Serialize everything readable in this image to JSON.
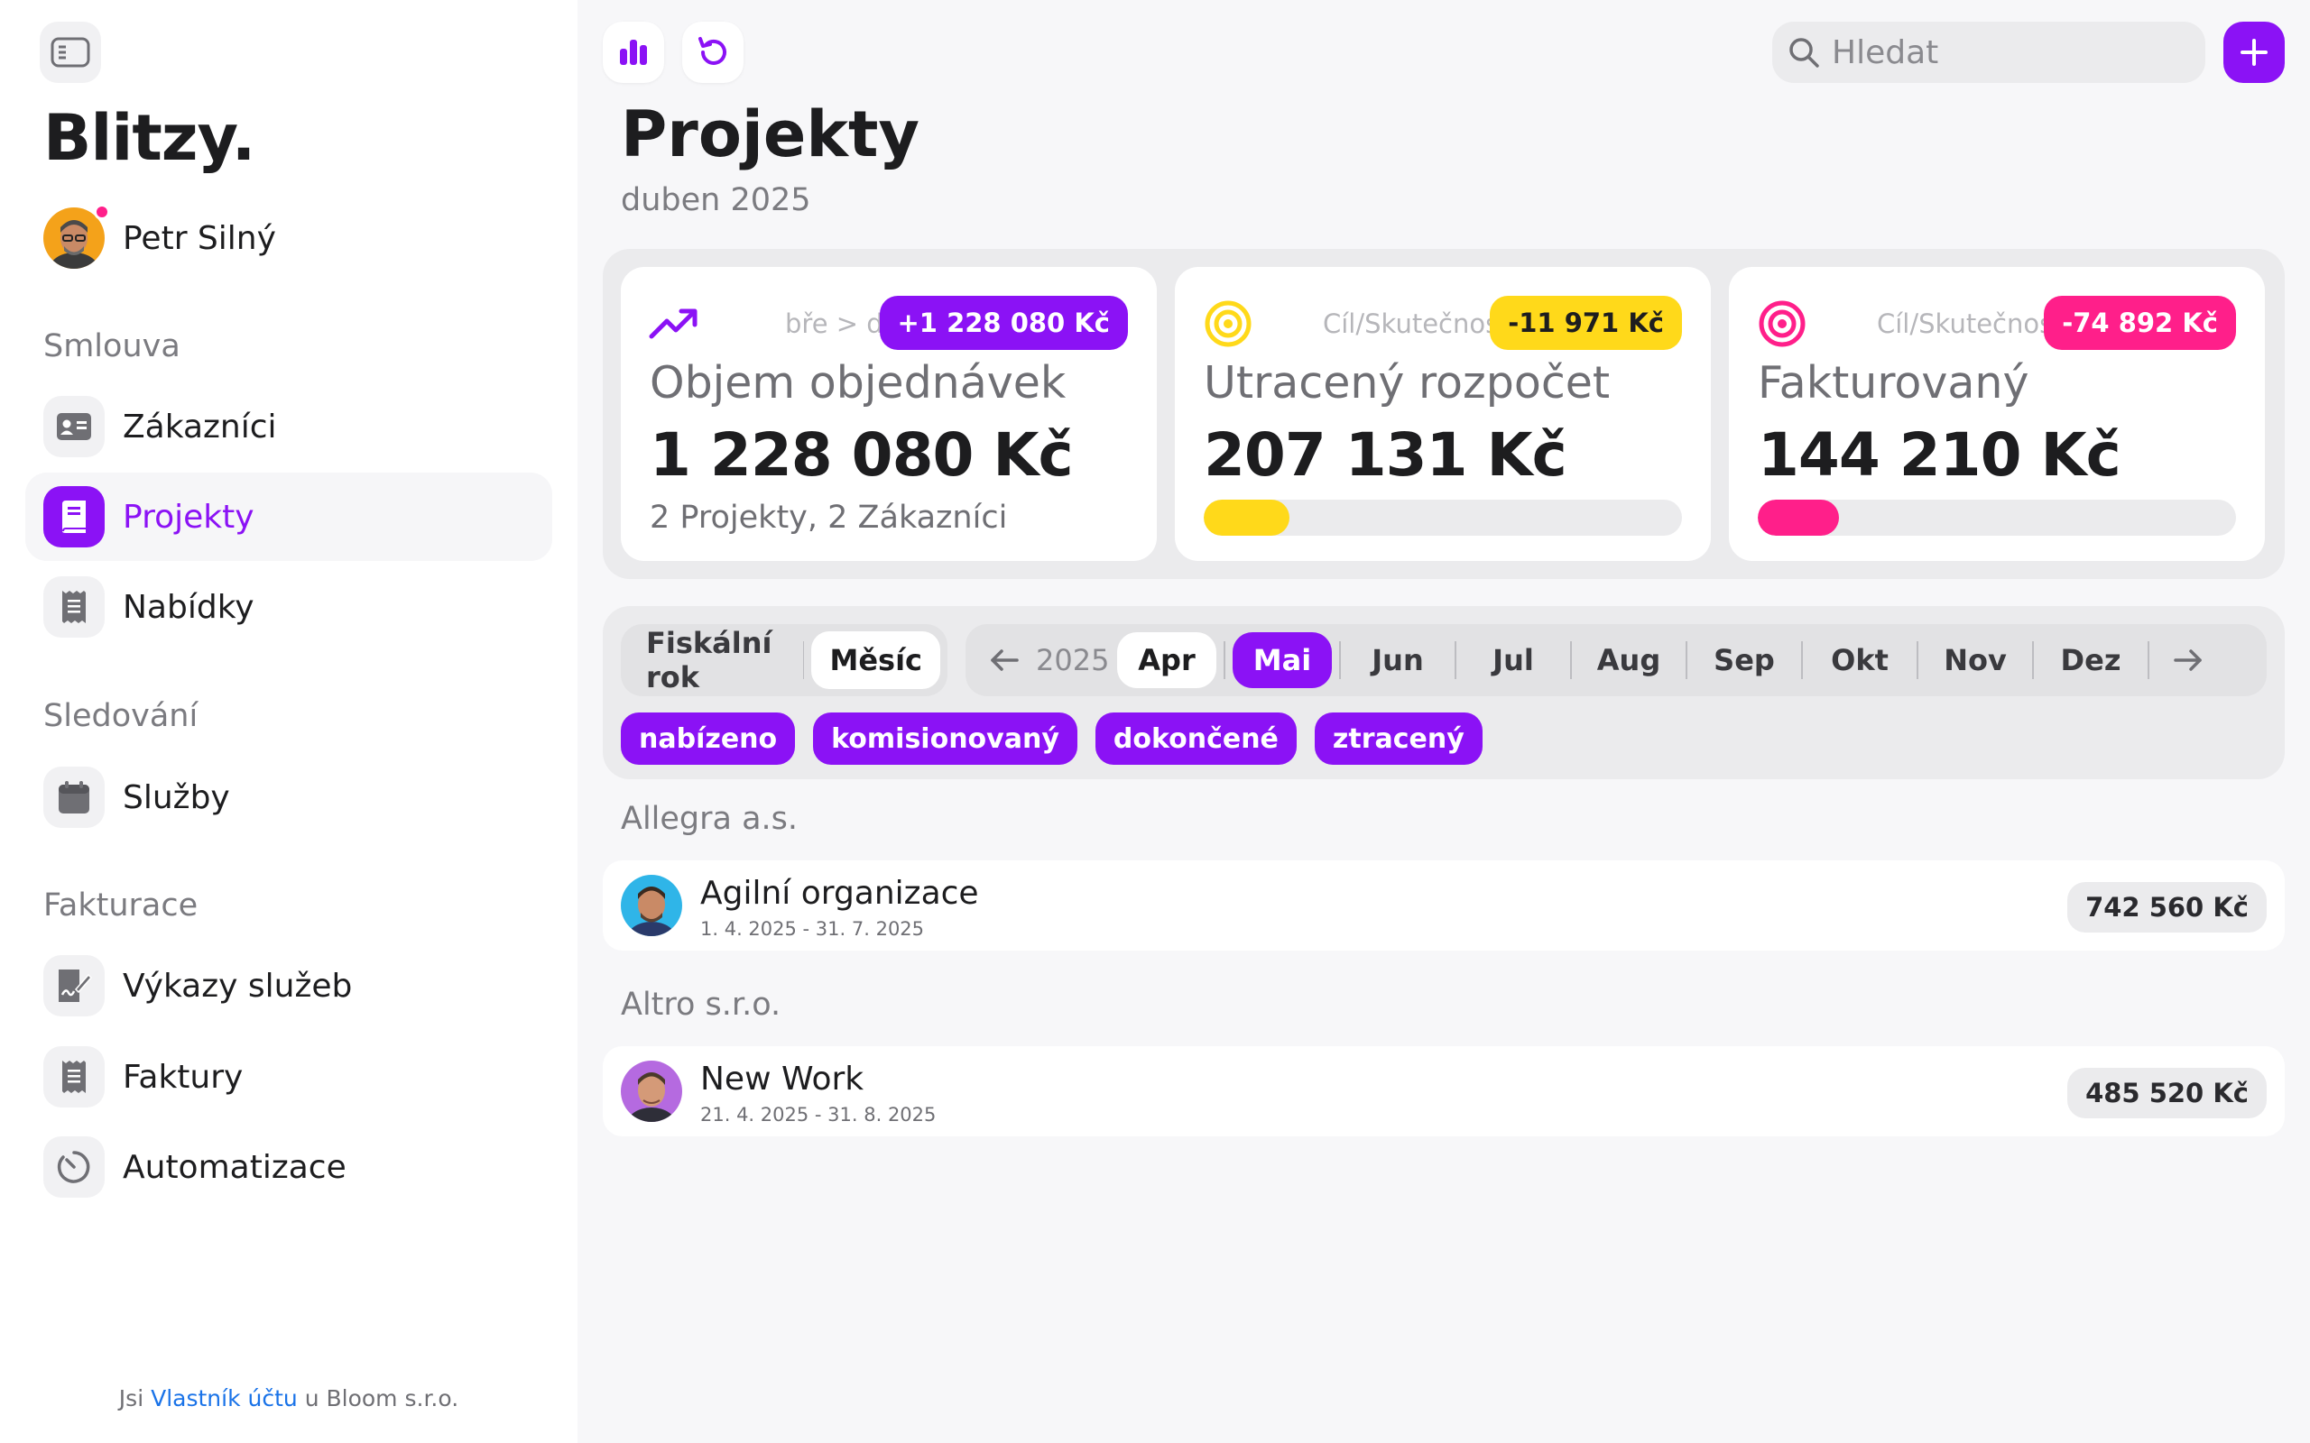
{
  "sidebar": {
    "logo": "Blitzy.",
    "user": {
      "name": "Petr Silný"
    },
    "sections": [
      {
        "title": "Smlouva",
        "items": [
          {
            "label": "Zákazníci",
            "icon": "id-card-icon"
          },
          {
            "label": "Projekty",
            "icon": "book-icon",
            "active": true
          },
          {
            "label": "Nabídky",
            "icon": "receipt-icon"
          }
        ]
      },
      {
        "title": "Sledování",
        "items": [
          {
            "label": "Služby",
            "icon": "calendar-icon"
          }
        ]
      },
      {
        "title": "Fakturace",
        "items": [
          {
            "label": "Výkazy služeb",
            "icon": "signed-document-icon"
          },
          {
            "label": "Faktury",
            "icon": "receipt-icon"
          },
          {
            "label": "Automatizace",
            "icon": "timer-icon"
          }
        ]
      }
    ],
    "footer": {
      "prefix": "Jsi",
      "link": "Vlastník účtu",
      "suffix": "u Bloom s.r.o."
    }
  },
  "toolbar": {
    "search_placeholder": "Hledat"
  },
  "page": {
    "title": "Projekty",
    "subtitle": "duben 2025"
  },
  "kpis": [
    {
      "icon": "trend-up-icon",
      "caption": "bře > dub",
      "badge": "+1 228 080 Kč",
      "badge_bg": "#8b12f5",
      "badge_fg": "#ffffff",
      "title": "Objem objednávek",
      "value": "1 228 080 Kč",
      "note": "2 Projekty, 2 Zákazníci"
    },
    {
      "icon": "target-icon",
      "caption": "Cíl/Skutečnost",
      "badge": "-11 971 Kč",
      "badge_bg": "#ffd91a",
      "badge_fg": "#1d1d1f",
      "title": "Utracený rozpočet",
      "value": "207 131 Kč",
      "progress": 0.18,
      "progress_color": "#ffd91a"
    },
    {
      "icon": "target-icon",
      "caption": "Cíl/Skutečnost",
      "badge": "-74 892 Kč",
      "badge_bg": "#ff1f8a",
      "badge_fg": "#ffffff",
      "title": "Fakturovaný",
      "value": "144 210 Kč",
      "progress": 0.17,
      "progress_color": "#ff1f8a"
    }
  ],
  "filters": {
    "period": {
      "options": [
        "Fiskální rok",
        "Měsíc"
      ],
      "selected": "Měsíc"
    },
    "year": "2025",
    "months": [
      "Apr",
      "Mai",
      "Jun",
      "Jul",
      "Aug",
      "Sep",
      "Okt",
      "Nov",
      "Dez"
    ],
    "tags": [
      "nabízeno",
      "komisionovaný",
      "dokončené",
      "ztracený"
    ]
  },
  "groups": [
    {
      "customer": "Allegra a.s.",
      "projects": [
        {
          "name": "Agilní organizace",
          "dates": "1. 4. 2025 - 31. 7. 2025",
          "amount": "742 560 Kč"
        }
      ]
    },
    {
      "customer": "Altro s.r.o.",
      "projects": [
        {
          "name": "New Work",
          "dates": "21. 4. 2025 - 31. 8. 2025",
          "amount": "485 520 Kč"
        }
      ]
    }
  ],
  "colors": {
    "accent": "#8b12f5",
    "yellow": "#ffd91a",
    "pink": "#ff1f8a"
  }
}
